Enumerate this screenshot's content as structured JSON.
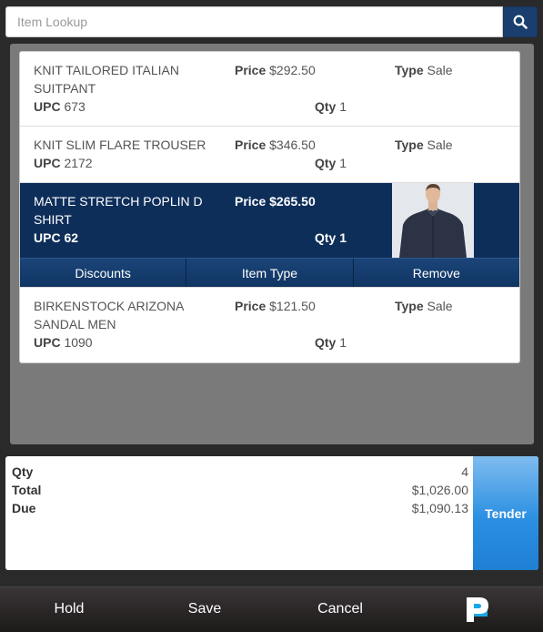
{
  "search": {
    "placeholder": "Item Lookup",
    "icon": "search-icon"
  },
  "labels": {
    "price": "Price",
    "type": "Type",
    "upc": "UPC",
    "qty": "Qty"
  },
  "items": [
    {
      "name": "KNIT TAILORED ITALIAN SUITPANT",
      "price": "$292.50",
      "type": "Sale",
      "upc": "673",
      "qty": "1"
    },
    {
      "name": "KNIT SLIM FLARE TROUSER",
      "price": "$346.50",
      "type": "Sale",
      "upc": "2172",
      "qty": "1"
    },
    {
      "name": "MATTE STRETCH POPLIN D SHIRT",
      "price": "$265.50",
      "type": "",
      "upc": "62",
      "qty": "1",
      "selected": true
    },
    {
      "name": "BIRKENSTOCK ARIZONA SANDAL MEN",
      "price": "$121.50",
      "type": "Sale",
      "upc": "1090",
      "qty": "1"
    }
  ],
  "item_actions": {
    "discounts": "Discounts",
    "item_type": "Item Type",
    "remove": "Remove"
  },
  "totals": {
    "qty_label": "Qty",
    "qty_value": "4",
    "total_label": "Total",
    "total_value": "$1,026.00",
    "due_label": "Due",
    "due_value": "$1,090.13"
  },
  "tender_label": "Tender",
  "footer": {
    "hold": "Hold",
    "save": "Save",
    "cancel": "Cancel",
    "logo_icon": "p-logo-icon"
  },
  "colors": {
    "selected": "#0e2e5a",
    "tender": "#2b8fe2",
    "search_button": "#1a3f6e"
  }
}
